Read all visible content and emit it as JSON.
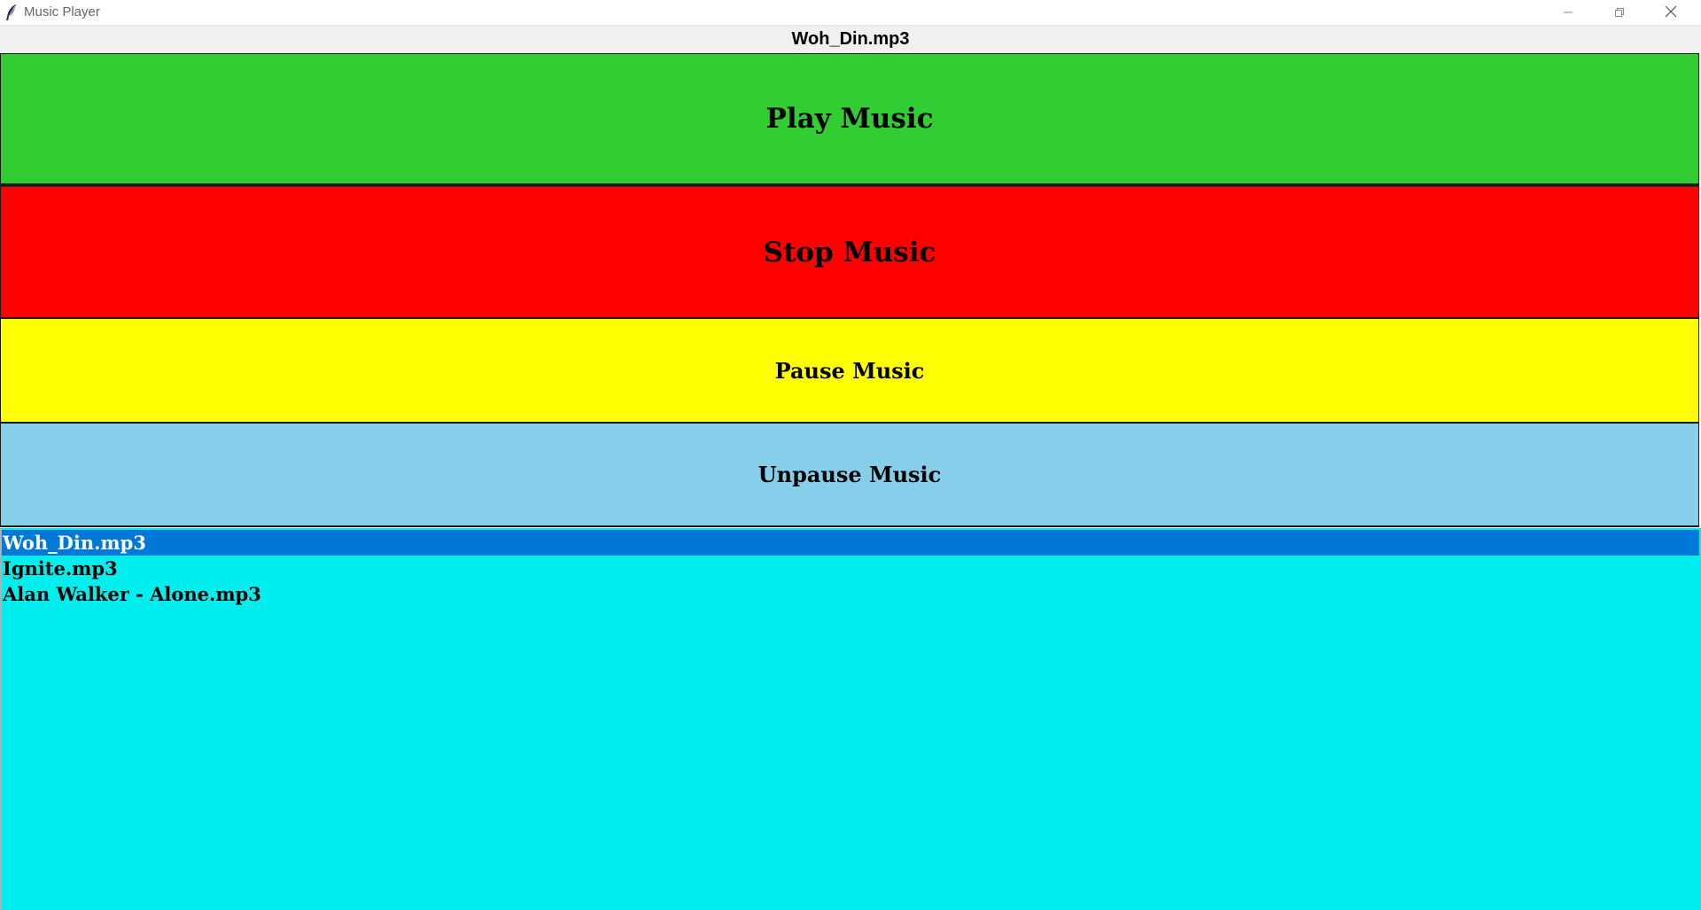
{
  "window": {
    "title": "Music Player",
    "icons": {
      "app": "feather-icon",
      "minimize": "minimize-icon",
      "maximize": "restore-icon",
      "close": "close-icon"
    }
  },
  "now_playing": {
    "label": "Woh_Din.mp3"
  },
  "controls": {
    "play_label": "Play Music",
    "stop_label": "Stop Music",
    "pause_label": "Pause Music",
    "unpause_label": "Unpause Music",
    "colors": {
      "play": "#32cd32",
      "stop": "#ff0000",
      "pause": "#ffff00",
      "unpause": "#87ceeb"
    }
  },
  "playlist": {
    "background": "#00eeee",
    "selected_color": "#0078d7",
    "selected_index": 0,
    "items": [
      "Woh_Din.mp3",
      "Ignite.mp3",
      "Alan Walker - Alone.mp3"
    ]
  }
}
